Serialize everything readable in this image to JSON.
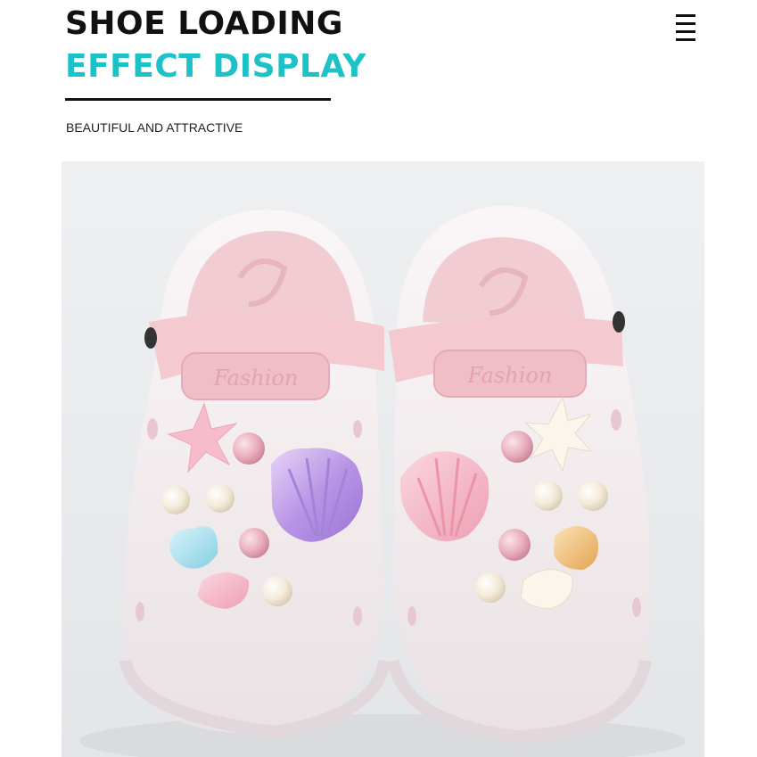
{
  "header": {
    "title_line1": "SHOE LOADING",
    "title_line2": "EFFECT DISPLAY",
    "subtitle": "BEAUTIFUL AND ATTRACTIVE",
    "accent_color": "#1cc2c8"
  },
  "menu": {
    "icon": "hamburger-menu-icon"
  },
  "product_image": {
    "strap_text": "Fashion",
    "colors": {
      "clog": "#f7f0f1",
      "strap": "#f4c9cf",
      "insole": "#f2ccd3",
      "background": "#eceef0"
    }
  }
}
